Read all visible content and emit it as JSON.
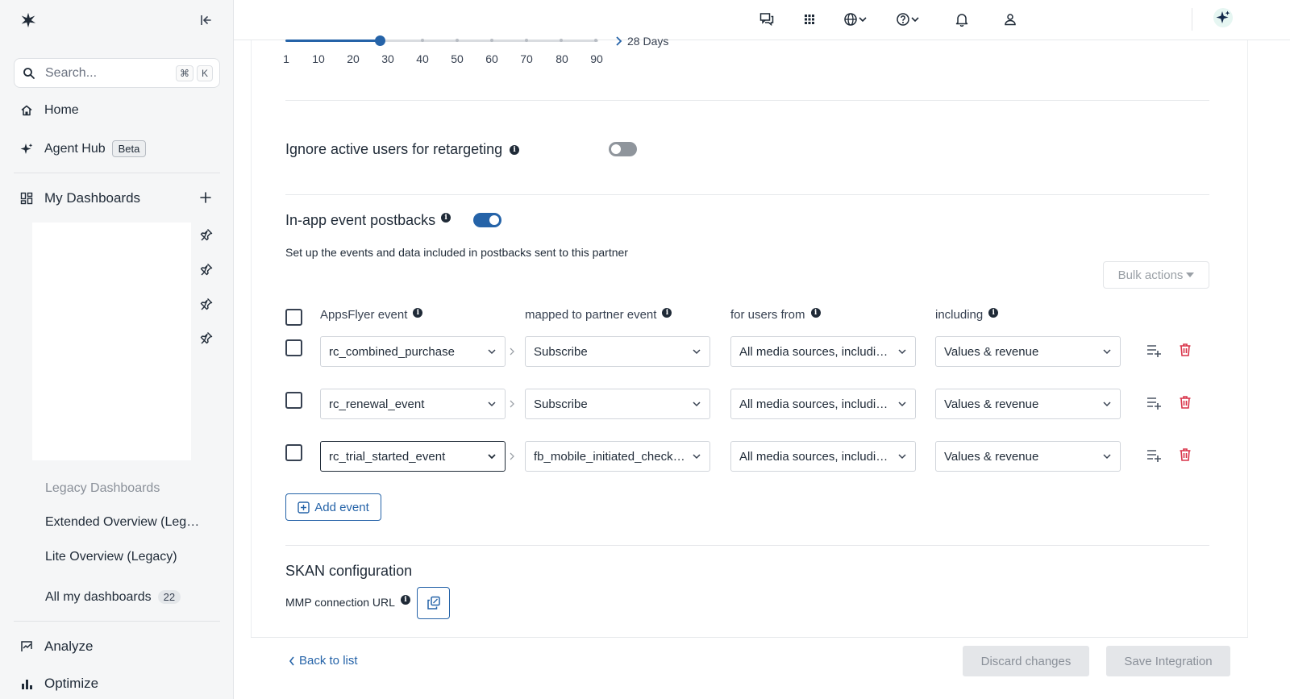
{
  "sidebar": {
    "search": {
      "placeholder": "Search...",
      "shortcut_mod": "⌘",
      "shortcut_key": "K"
    },
    "home_label": "Home",
    "agent_hub_label": "Agent Hub",
    "agent_hub_badge": "Beta",
    "my_dashboards_label": "My Dashboards",
    "legacy_title": "Legacy Dashboards",
    "legacy_items": [
      "Extended Overview (Legacy)",
      "Lite Overview (Legacy)"
    ],
    "all_dashboards_label": "All my dashboards",
    "all_dashboards_count": "22",
    "analyze_label": "Analyze",
    "optimize_label": "Optimize"
  },
  "slider": {
    "ticks": [
      "1",
      "10",
      "20",
      "30",
      "40",
      "50",
      "60",
      "70",
      "80",
      "90"
    ],
    "value_label": "28 Days",
    "value": 28
  },
  "retargeting": {
    "label": "Ignore active users for retargeting",
    "enabled": false
  },
  "postbacks": {
    "label": "In-app event postbacks",
    "enabled": true,
    "description": "Set up the events and data included in postbacks sent to this partner",
    "bulk_actions_label": "Bulk actions",
    "columns": {
      "appsflyer_event": "AppsFlyer event",
      "partner_event": "mapped to partner event",
      "users_from": "for users from",
      "including": "including"
    },
    "rows": [
      {
        "event": "rc_combined_purchase",
        "partner": "Subscribe",
        "users": "All media sources, including organic",
        "including": "Values & revenue"
      },
      {
        "event": "rc_renewal_event",
        "partner": "Subscribe",
        "users": "All media sources, including organic",
        "including": "Values & revenue"
      },
      {
        "event": "rc_trial_started_event",
        "partner": "fb_mobile_initiated_checkout",
        "users": "All media sources, including organic",
        "including": "Values & revenue"
      }
    ],
    "add_event_label": "Add event"
  },
  "skan": {
    "title": "SKAN configuration",
    "mmp_label": "MMP connection URL"
  },
  "footer": {
    "back_label": "Back to list",
    "discard_label": "Discard changes",
    "save_label": "Save Integration"
  },
  "colors": {
    "accent": "#2563a8",
    "delete": "#d9344a"
  }
}
